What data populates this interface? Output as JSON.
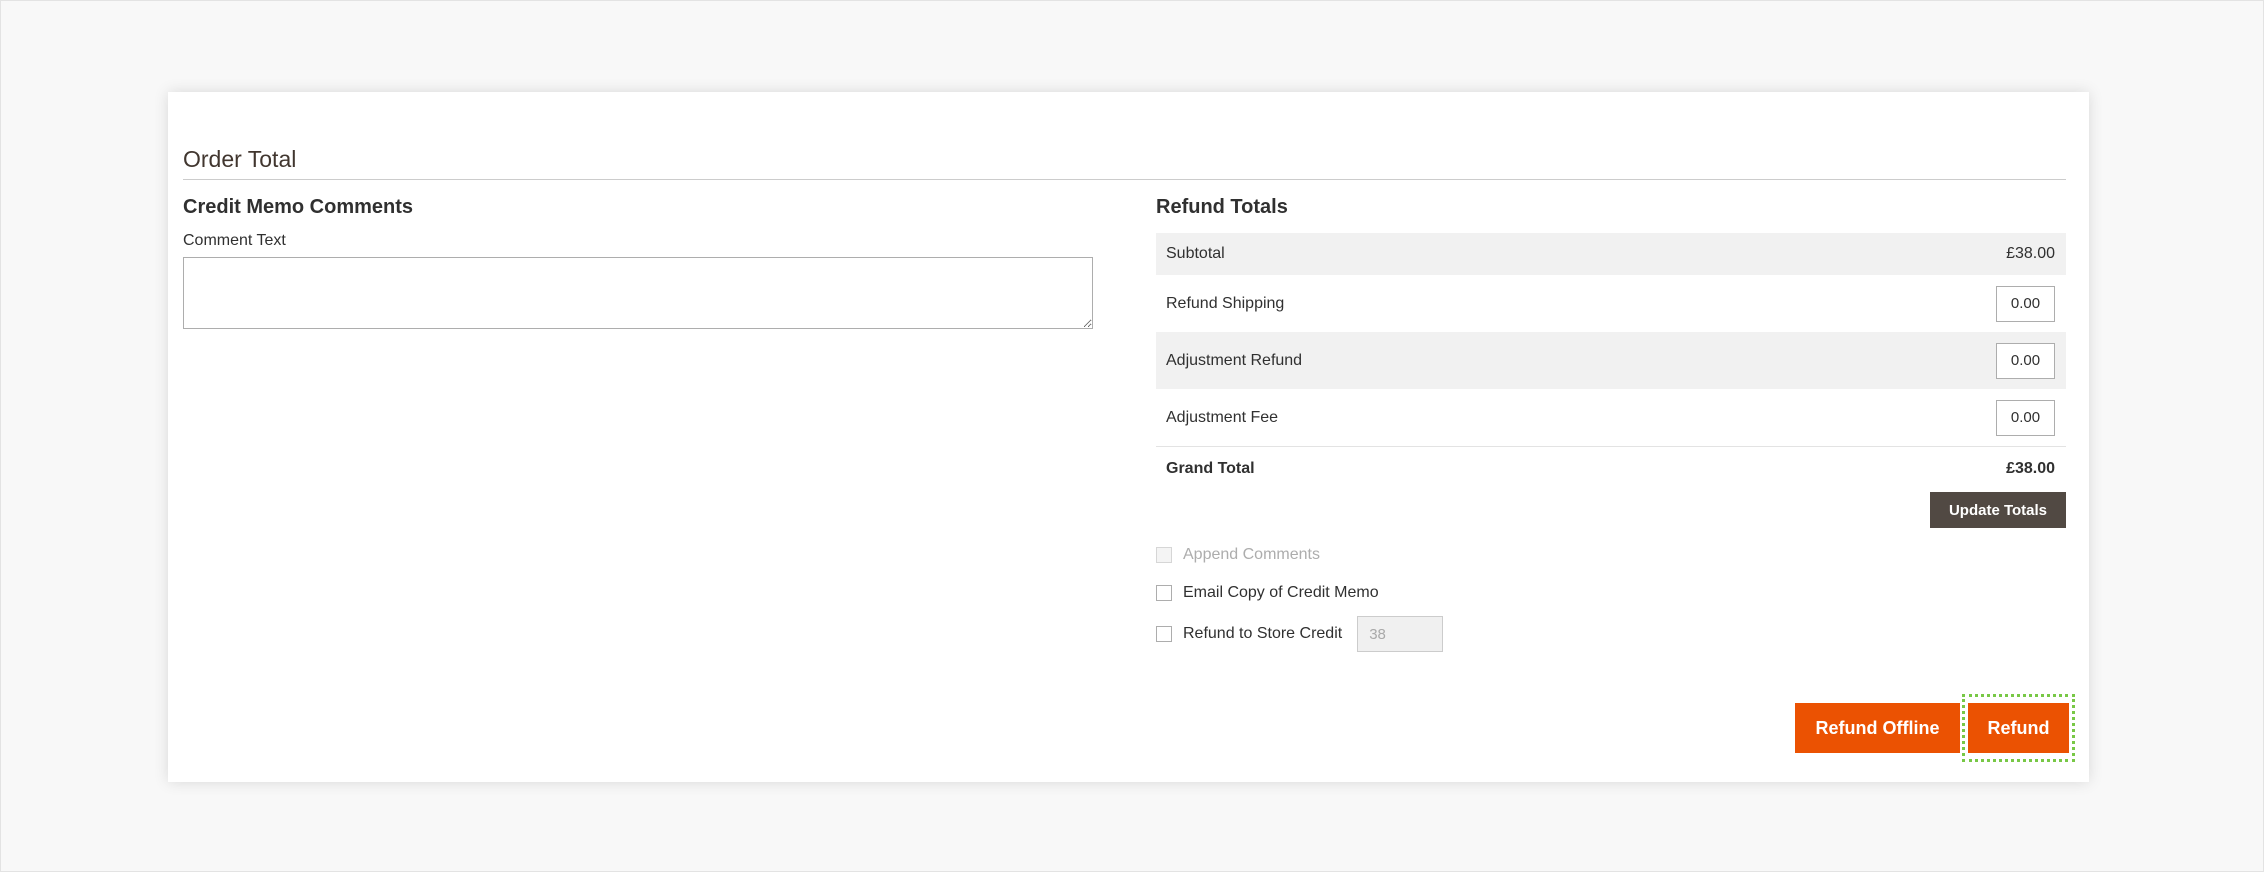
{
  "section": {
    "title": "Order Total"
  },
  "comments": {
    "heading": "Credit Memo Comments",
    "label": "Comment Text",
    "value": ""
  },
  "refund_totals": {
    "heading": "Refund Totals",
    "subtotal_label": "Subtotal",
    "subtotal_value": "£38.00",
    "shipping_label": "Refund Shipping",
    "shipping_value": "0.00",
    "adjustment_refund_label": "Adjustment Refund",
    "adjustment_refund_value": "0.00",
    "adjustment_fee_label": "Adjustment Fee",
    "adjustment_fee_value": "0.00",
    "grand_total_label": "Grand Total",
    "grand_total_value": "£38.00",
    "update_button": "Update Totals"
  },
  "options": {
    "append_comments": "Append Comments",
    "email_copy": "Email Copy of Credit Memo",
    "store_credit": "Refund to Store Credit",
    "store_credit_value": "38"
  },
  "actions": {
    "refund_offline": "Refund Offline",
    "refund": "Refund"
  },
  "colors": {
    "primary": "#eb5202",
    "secondary": "#514943",
    "focus_outline": "#78c846"
  }
}
